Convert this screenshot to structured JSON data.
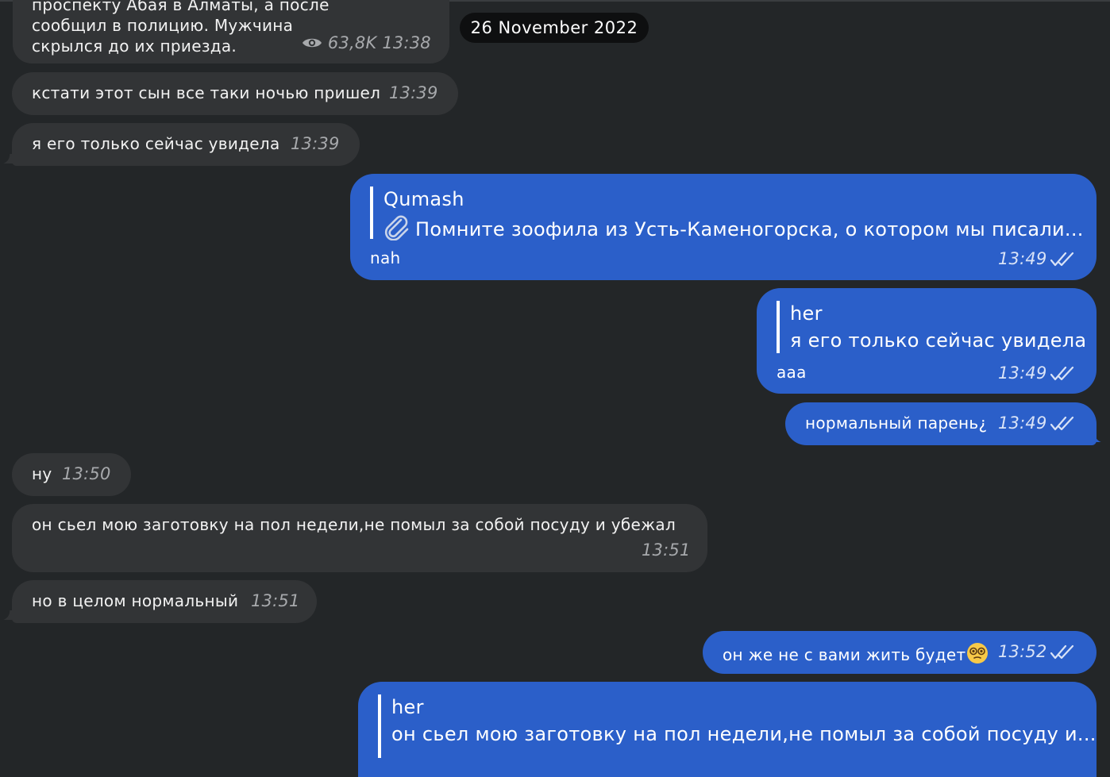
{
  "date_separator": "26 November 2022",
  "messages": [
    {
      "lines": [
        "проспекту Абая в Алматы, а после",
        "сообщил в полицию. Мужчина",
        "скрылся до их приезда."
      ],
      "views": "63,8K",
      "time": "13:38"
    },
    {
      "text": "кстати этот сын все таки ночью пришел",
      "time": "13:39"
    },
    {
      "text": "я его только сейчас увидела",
      "time": "13:39"
    },
    {
      "reply_author": "Qumash",
      "reply_text": "Помните зоофила из Усть-Каменогорска, о котором мы писали...",
      "reply_icon": "paperclip-icon",
      "text": "nah",
      "time": "13:49"
    },
    {
      "reply_author": "her",
      "reply_text": "я его только сейчас увидела",
      "text": "aaa",
      "time": "13:49"
    },
    {
      "text": "нормальный парень¿",
      "time": "13:49"
    },
    {
      "text": "ну",
      "time": "13:50"
    },
    {
      "text": "он сьел мою заготовку на пол недели,не помыл за собой посуду и убежал",
      "time": "13:51"
    },
    {
      "text": "но в целом нормальный",
      "time": "13:51"
    },
    {
      "text": "он же не с вами жить будет",
      "emoji": "dizzy-face-emoji",
      "time": "13:52"
    },
    {
      "reply_author": "her",
      "reply_text": "он сьел мою заготовку на пол недели,не помыл за собой посуду и..."
    }
  ],
  "colors": {
    "background": "#232628",
    "incoming_bubble": "#323436",
    "outgoing_bubble": "#2b5fc9",
    "date_pill": "#0e0f10"
  }
}
